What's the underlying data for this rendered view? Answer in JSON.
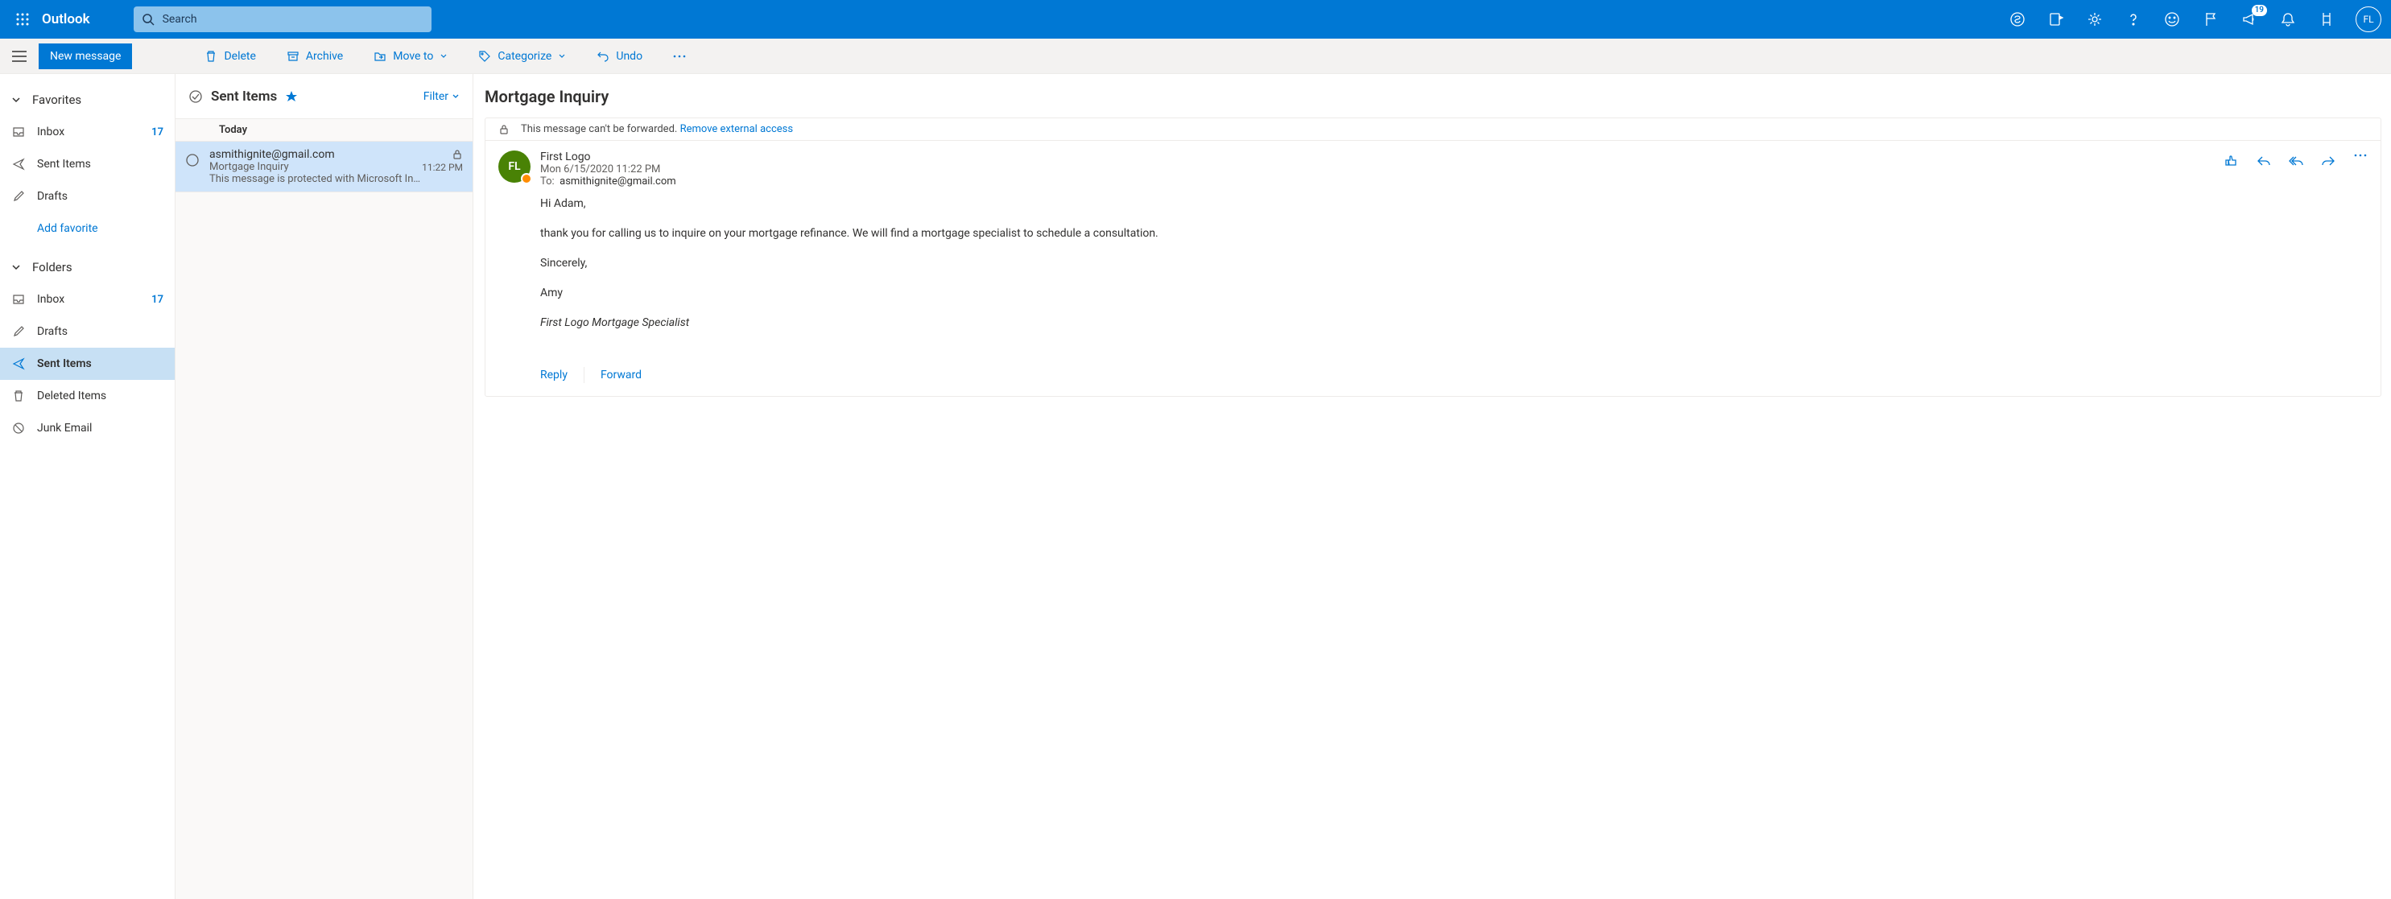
{
  "header": {
    "brand": "Outlook",
    "search_placeholder": "Search",
    "meet_badge": "19",
    "avatar_initials": "FL"
  },
  "cmd": {
    "new": "New message",
    "delete": "Delete",
    "archive": "Archive",
    "move": "Move to",
    "categorize": "Categorize",
    "undo": "Undo"
  },
  "nav": {
    "fav_header": "Favorites",
    "folders_header": "Folders",
    "inbox": "Inbox",
    "inbox_count": "17",
    "sent": "Sent Items",
    "drafts": "Drafts",
    "add_fav": "Add favorite",
    "deleted": "Deleted Items",
    "junk": "Junk Email"
  },
  "list": {
    "title": "Sent Items",
    "filter": "Filter",
    "group": "Today",
    "item": {
      "from": "asmithignite@gmail.com",
      "subject": "Mortgage Inquiry",
      "time": "11:22 PM",
      "preview": "This message is protected with Microsoft In…"
    }
  },
  "read": {
    "subject": "Mortgage Inquiry",
    "banner_text": "This message can't be forwarded.",
    "banner_link": "Remove external access",
    "sender": "First Logo",
    "sender_initials": "FL",
    "date": "Mon 6/15/2020 11:22 PM",
    "to_label": "To:",
    "to_value": "asmithignite@gmail.com",
    "body_greeting": "Hi Adam,",
    "body_main": " thank you for calling us to inquire on your mortgage refinance.  We will find a mortgage specialist to schedule a consultation.",
    "body_close": "Sincerely,",
    "body_name": "Amy",
    "body_sig": "First Logo Mortgage Specialist",
    "reply": "Reply",
    "forward": "Forward"
  }
}
